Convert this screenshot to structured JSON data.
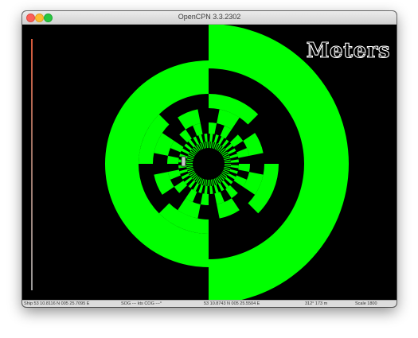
{
  "window": {
    "title": "OpenCPN 3.3.2302"
  },
  "chart": {
    "units_label": "Meters",
    "pattern_color": "#00ff00",
    "background_color": "#000000"
  },
  "status": {
    "ship": "Ship 53 10.8116 N   005 25.7095 E",
    "sog_cog": "SOG --- kts  COG ---°",
    "cursor": "53 10.8743 N   005 25.5504 E",
    "bearing_range": "312°  173 m",
    "scale": "Scale 1800"
  }
}
